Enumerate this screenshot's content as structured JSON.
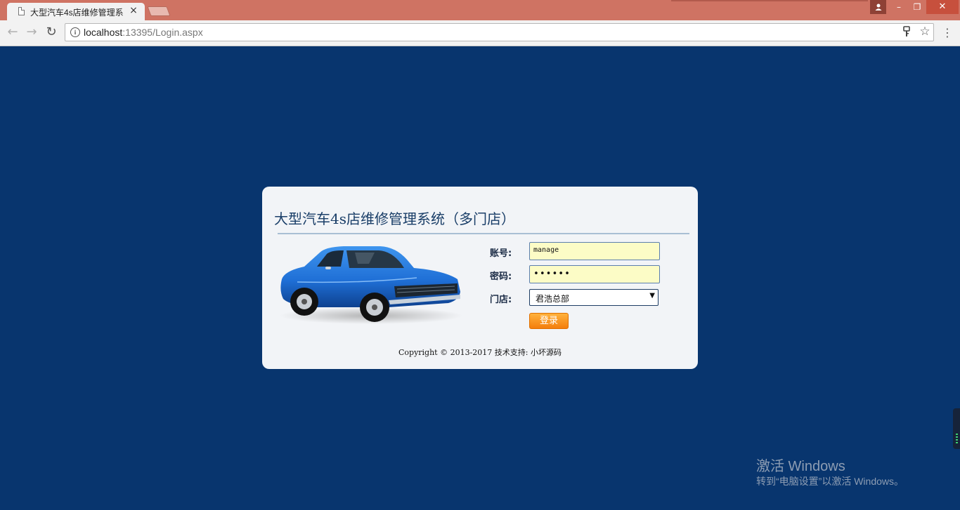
{
  "browser": {
    "tab_title": "大型汽车4s店维修管理系",
    "tab_close": "×",
    "url_host": "localhost",
    "url_rest": ":13395/Login.aspx",
    "nav": {
      "back": "←",
      "forward": "→",
      "reload": "↻"
    },
    "window_controls": {
      "minimize": "–",
      "restore": "❐",
      "close": "✕"
    },
    "icons": [
      "page-icon",
      "info-icon",
      "key-icon",
      "star-icon",
      "menu-icon",
      "user-icon"
    ]
  },
  "login": {
    "title": "大型汽车4s店维修管理系统（多门店）",
    "account_label": "账号:",
    "account_value": "manage",
    "password_label": "密码:",
    "password_value": "••••••",
    "store_label": "门店:",
    "store_selected": "君浩总部",
    "submit_label": "登录",
    "copyright": "Copyright © 2013-2017 技术支持: 小坏源码"
  },
  "watermark": {
    "title": "激活 Windows",
    "subtitle": "转到“电脑设置”以激活 Windows。"
  },
  "colors": {
    "page_background": "#08356e",
    "titlebar": "#cf7363",
    "card_background": "#f2f4f7",
    "input_background": "#fcfcc6",
    "button_orange": "#f47e0c",
    "car_blue": "#1f6fd6"
  }
}
